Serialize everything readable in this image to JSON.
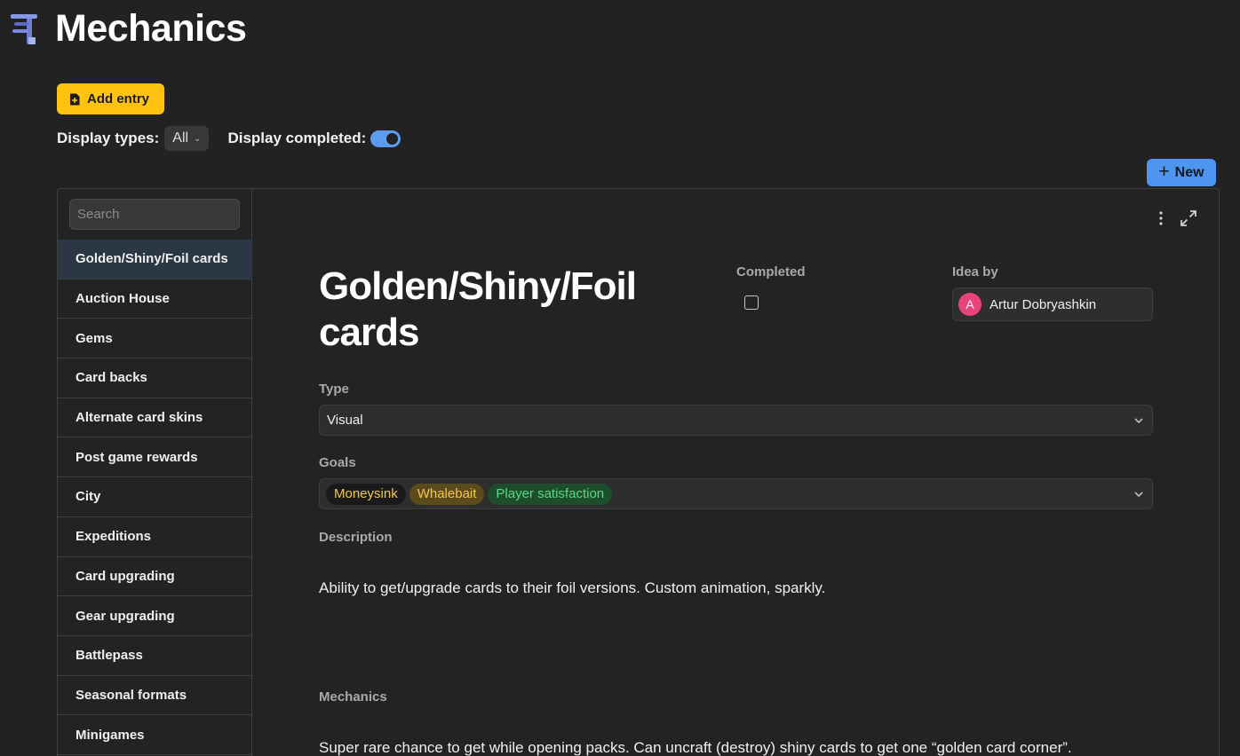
{
  "page": {
    "icon": "caliper-icon",
    "title": "Mechanics"
  },
  "toolbar": {
    "add_entry_label": "Add entry",
    "add_entry_icon": "document-plus-icon",
    "display_types_label": "Display types:",
    "display_types_value": "All",
    "display_completed_label": "Display completed:",
    "display_completed_on": true,
    "new_label": "New"
  },
  "sidebar": {
    "search_placeholder": "Search",
    "items": [
      {
        "label": "Golden/Shiny/Foil cards",
        "active": true
      },
      {
        "label": "Auction House"
      },
      {
        "label": "Gems"
      },
      {
        "label": "Card backs"
      },
      {
        "label": "Alternate card skins"
      },
      {
        "label": "Post game rewards"
      },
      {
        "label": "City"
      },
      {
        "label": "Expeditions"
      },
      {
        "label": "Card upgrading"
      },
      {
        "label": "Gear upgrading"
      },
      {
        "label": "Battlepass"
      },
      {
        "label": "Seasonal formats"
      },
      {
        "label": "Minigames"
      }
    ]
  },
  "detail": {
    "title": "Golden/Shiny/Foil cards",
    "completed_label": "Completed",
    "completed": false,
    "idea_by_label": "Idea by",
    "idea_by": {
      "initial": "A",
      "name": "Artur Dobryashkin",
      "avatar_color": "#e8437b"
    },
    "type_label": "Type",
    "type_value": "Visual",
    "goals_label": "Goals",
    "goals": [
      {
        "label": "Moneysink",
        "color": "#f2c94c"
      },
      {
        "label": "Whalebait",
        "color": "#f5c64a"
      },
      {
        "label": "Player satisfaction",
        "color": "#5bd685"
      }
    ],
    "description_label": "Description",
    "description": "Ability to get/upgrade cards to their foil versions. Custom animation, sparkly.",
    "mechanics_label": "Mechanics",
    "mechanics": "Super rare chance to get while opening packs. Can uncraft (destroy) shiny cards to get one “golden card corner”."
  },
  "colors": {
    "background": "#222222",
    "accent_yellow": "#ffc20e",
    "accent_blue": "#4d95ee",
    "active_row": "#2b3744"
  }
}
